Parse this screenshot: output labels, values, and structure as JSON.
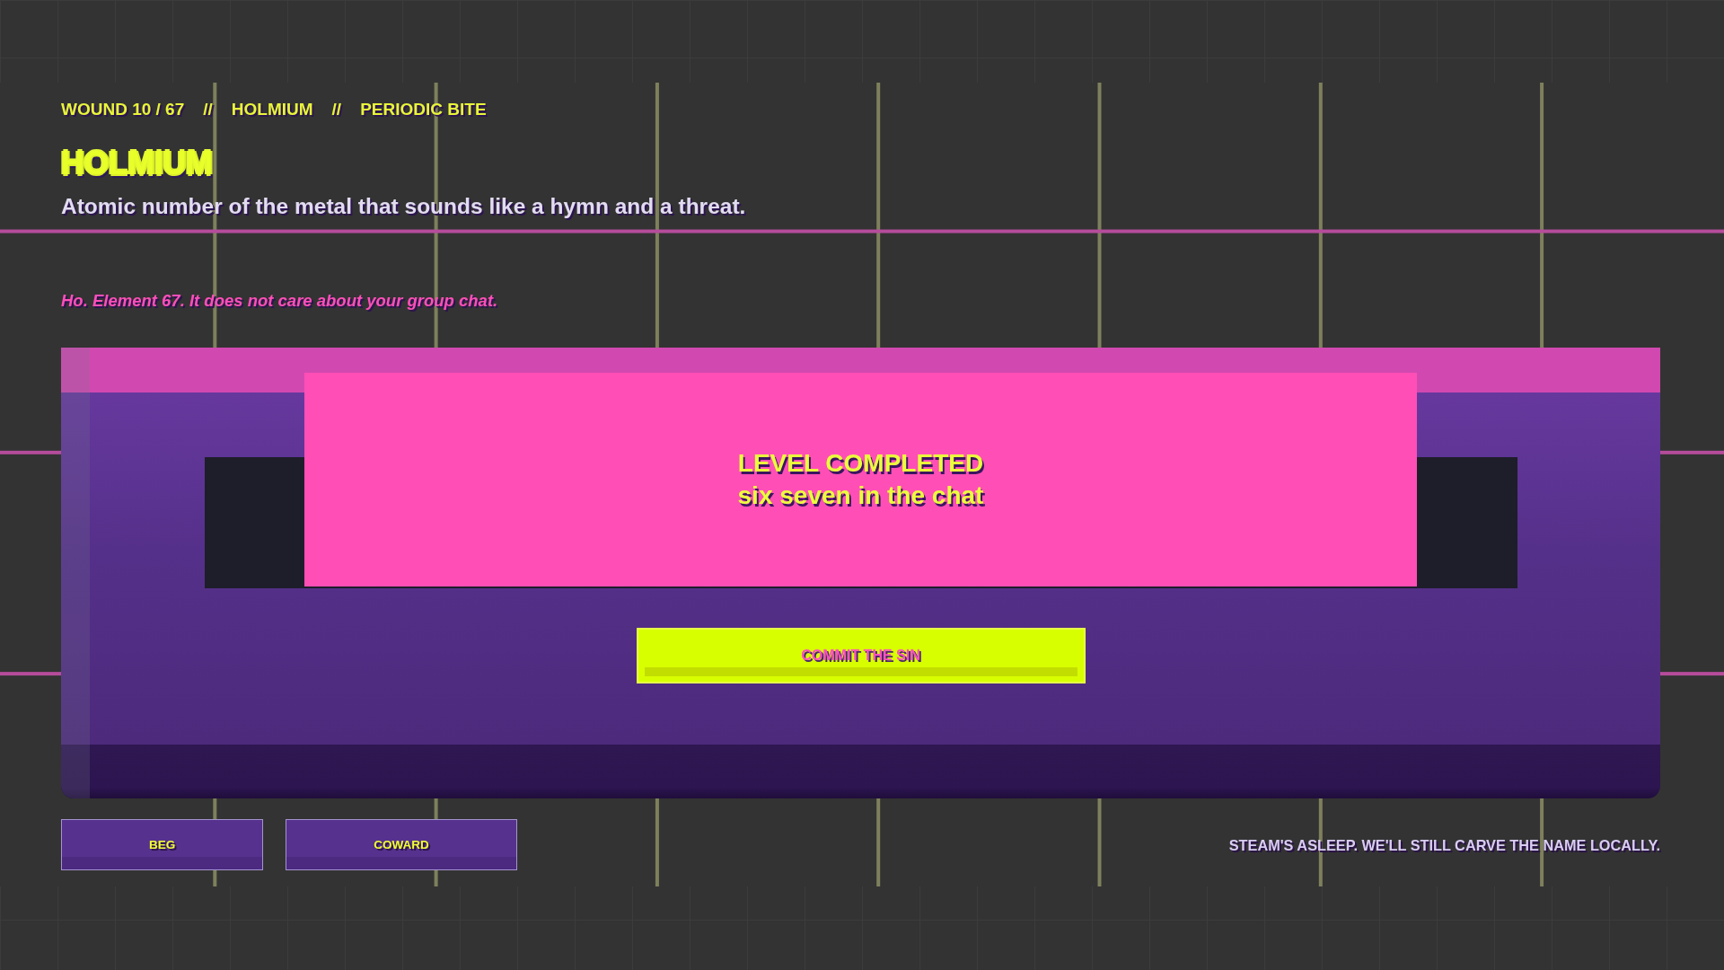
{
  "header_label": [
    "WOUND 10 / 67",
    "//",
    "HOLMIUM",
    "//",
    "PERIODIC BITE"
  ],
  "title": "HOLMIUM",
  "question": "Atomic number of the metal that sounds like a hymn and a threat.",
  "hint": "Ho. Element 67. It does not care about your group chat.",
  "result_banner": {
    "heading": "LEVEL COMPLETED",
    "subheading": "six seven in the chat"
  },
  "primary_button": "COMMIT THE SIN",
  "secondary_buttons": [
    "BEG",
    "COWARD"
  ],
  "status_note": "STEAM'S ASLEEP. WE'LL STILL CARVE THE NAME LOCALLY."
}
